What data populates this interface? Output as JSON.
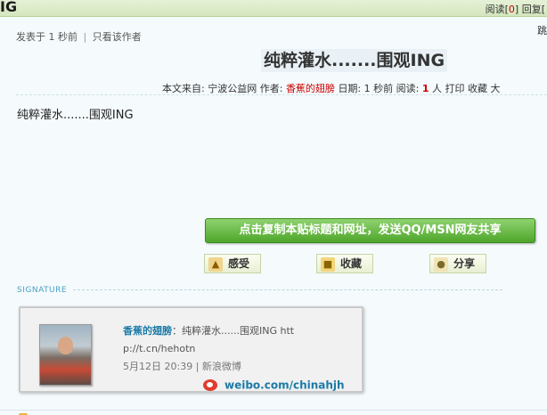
{
  "topbar": {
    "title_fragment": "IG",
    "views_label": "阅读",
    "views_open": "[",
    "views_count": "0",
    "views_close": "]",
    "replies_label": "回复",
    "replies_open": "["
  },
  "post": {
    "posted_prefix": "发表于",
    "posted_time": "1 秒前",
    "separator": "|",
    "only_author": "只看该作者",
    "edge_fragment": "跳",
    "title": "纯粹灌水.......围观ING",
    "meta": {
      "source_label": "本文来自:",
      "source": "宁波公益网",
      "author_label": "作者:",
      "author": "香蕉的翅膀",
      "date_label": "日期:",
      "date": "1 秒前",
      "reads_label": "阅读:",
      "reads_count": "1",
      "reads_unit": "人",
      "print": "打印",
      "favorite": "收藏",
      "font_large": "大"
    },
    "body": "纯粹灌水.......围观ING"
  },
  "actions": {
    "copy_button": "点击复制本贴标题和网址，发送QQ/MSN网友共享",
    "feel": "感受",
    "collect": "收藏",
    "share": "分享"
  },
  "signature": {
    "label": "SIGNATURE",
    "name": "香蕉的翅膀",
    "colon": "：",
    "tweet": "纯粹灌水......围观ING htt p://t.cn/hehotn",
    "time": "5月12日 20:39 | 新浪微博",
    "weibo_link": "weibo.com/chinahjh"
  },
  "icons": {
    "feel": "thumbs-up-icon",
    "collect": "folder-icon",
    "share": "share-icon",
    "weibo": "weibo-logo-icon"
  },
  "colors": {
    "accent_red": "#cc0000",
    "link_blue": "#1c7aa6",
    "button_green": "#4ea62a"
  }
}
